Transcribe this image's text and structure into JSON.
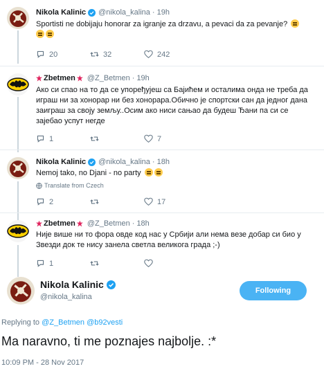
{
  "tweets": [
    {
      "name": "Nikola Kalinic",
      "handle": "@nikola_kalina",
      "time": "19h",
      "text": "Sportisti ne dobijaju honorar za igranje za drzavu, a pevaci da za pevanje?",
      "replies": "20",
      "retweets": "32",
      "likes": "242"
    },
    {
      "name": "Zbetmen",
      "handle": "@Z_Betmen",
      "time": "19h",
      "text": "Ако си спао на то да се упоређујеш са Бајићем и осталима онда не треба да играш ни за хонорар ни без хонорара.Обично је спортски сан да једног дана заиграш за своју земљу..Осим ако ниси сањао да будеш Ђани па си се зајебао успут негде",
      "replies": "1",
      "retweets": "",
      "likes": "7"
    },
    {
      "name": "Nikola Kalinic",
      "handle": "@nikola_kalina",
      "time": "18h",
      "text": "Nemoj tako, no Djani - no party",
      "translate": "Translate from Czech",
      "replies": "2",
      "retweets": "",
      "likes": "17"
    },
    {
      "name": "Zbetmen",
      "handle": "@Z_Betmen",
      "time": "18h",
      "text": "Није више ни то фора овде код нас у Србији али нема везе добар си био у Звезди док те нису занела светла великога града ;-)",
      "replies": "1",
      "retweets": "",
      "likes": ""
    }
  ],
  "main_tweet": {
    "name": "Nikola Kalinic",
    "handle": "@nikola_kalina",
    "follow_label": "Following",
    "replying_prefix": "Replying to",
    "replying_to_1": "@Z_Betmen",
    "replying_to_2": "@b92vesti",
    "text": "Ma naravno, ti me poznajes najbolje. :*",
    "timestamp": "10:09 PM - 28 Nov 2017"
  },
  "colors": {
    "accent": "#1da1f2",
    "follow_button": "#4ab3f4",
    "secondary_text": "#657786",
    "divider": "#e6ecf0"
  },
  "icons": [
    "reply-icon",
    "retweet-icon",
    "like-icon",
    "verified-badge-icon",
    "globe-icon"
  ]
}
